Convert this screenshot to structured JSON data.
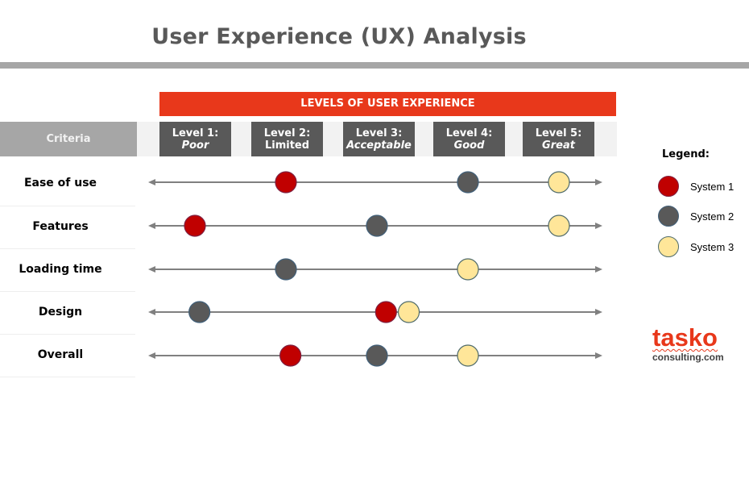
{
  "title": "User Experience (UX) Analysis",
  "banner": "LEVELS OF USER EXPERIENCE",
  "criteria_header": "Criteria",
  "levels": [
    {
      "line1": "Level 1:",
      "line2": "Poor",
      "italic": true
    },
    {
      "line1": "Level 2:",
      "line2": "Limited",
      "italic": false
    },
    {
      "line1": "Level 3:",
      "line2": "Acceptable",
      "italic": true
    },
    {
      "line1": "Level 4:",
      "line2": "Good",
      "italic": true
    },
    {
      "line1": "Level 5:",
      "line2": "Great",
      "italic": true
    }
  ],
  "legend": {
    "title": "Legend:",
    "items": [
      {
        "label": "System 1",
        "fill": "#c00000",
        "stroke": "#7f2040"
      },
      {
        "label": "System 2",
        "fill": "#595959",
        "stroke": "#41607a"
      },
      {
        "label": "System 3",
        "fill": "#ffe699",
        "stroke": "#4f6b6b"
      }
    ]
  },
  "logo": {
    "main": "tasko",
    "sub": "consulting.com"
  },
  "colors": {
    "accent": "#e8381b",
    "level_box": "#595959",
    "criteria_box": "#a6a6a6",
    "axis": "#808080"
  },
  "chart_data": {
    "type": "scatter",
    "title": "User Experience (UX) Analysis",
    "xlabel": "Levels of User Experience",
    "ylabel": "Criteria",
    "xlim": [
      1,
      5
    ],
    "x_ticks": [
      "Level 1: Poor",
      "Level 2: Limited",
      "Level 3: Acceptable",
      "Level 4: Good",
      "Level 5: Great"
    ],
    "categories": [
      "Ease of use",
      "Features",
      "Loading time",
      "Design",
      "Overall"
    ],
    "series": [
      {
        "name": "System 1",
        "values": [
          2.0,
          1.0,
          null,
          3.1,
          2.05
        ]
      },
      {
        "name": "System 2",
        "values": [
          4.0,
          3.0,
          2.0,
          1.05,
          3.0
        ]
      },
      {
        "name": "System 3",
        "values": [
          5.0,
          5.0,
          4.0,
          3.35,
          4.0
        ]
      }
    ],
    "legend_position": "right",
    "grid": false
  }
}
